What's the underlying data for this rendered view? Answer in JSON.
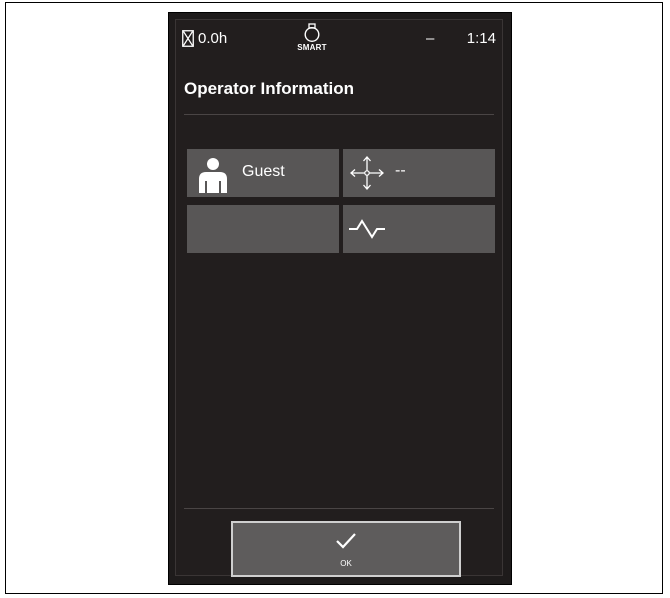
{
  "status_bar": {
    "hours": "0.0h",
    "smart_label": "SMART",
    "indicator": "–",
    "time": "1:14"
  },
  "page": {
    "title": "Operator Information"
  },
  "tiles": {
    "operator_name": "Guest",
    "movement_value": "--"
  },
  "footer": {
    "ok_label": "OK"
  },
  "icons": {
    "hourglass": "hourglass-icon",
    "smart": "smart-icon",
    "person": "person-icon",
    "movement": "move-arrows-icon",
    "signal": "signal-wave-icon",
    "check": "check-icon"
  },
  "colors": {
    "screen_background": "#221e1e",
    "tile": "#585656",
    "button": "#5e5c5c",
    "text": "#ffffff"
  }
}
